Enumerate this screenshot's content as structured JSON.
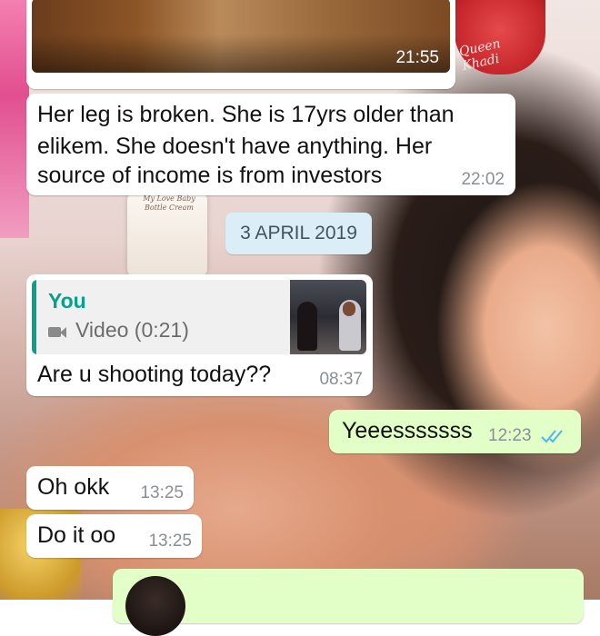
{
  "wallpaper": {
    "brand_text": "Queen Khadi",
    "product_text": "My Love Baby Bottle Cream"
  },
  "messages": [
    {
      "id": "media",
      "direction": "incoming",
      "time": "21:55"
    },
    {
      "id": "m1",
      "direction": "incoming",
      "lines": [
        "Her leg is broken. She is 17yrs older than",
        "elikem. She doesn't  have anything. Her",
        "source of income is from investors"
      ],
      "time": "22:02"
    },
    {
      "id": "m2",
      "direction": "incoming",
      "reply": {
        "name": "You",
        "label": "Video (0:21)"
      },
      "text": "Are u shooting today??",
      "time": "08:37"
    },
    {
      "id": "m3",
      "direction": "outgoing",
      "text": "Yeeesssssss",
      "time": "12:23",
      "status": "read"
    },
    {
      "id": "m4",
      "direction": "incoming",
      "text": "Oh okk",
      "time": "13:25"
    },
    {
      "id": "m5",
      "direction": "incoming",
      "text": "Do it oo",
      "time": "13:25"
    }
  ],
  "date_divider": "3 APRIL 2019",
  "colors": {
    "incoming_bubble": "#ffffff",
    "outgoing_bubble": "#e2ffc8",
    "reply_accent": "#07a088",
    "read_ticks": "#4fb6ec",
    "date_chip": "#dbeef7"
  },
  "icons": [
    "video-camera-icon",
    "double-check-icon"
  ]
}
